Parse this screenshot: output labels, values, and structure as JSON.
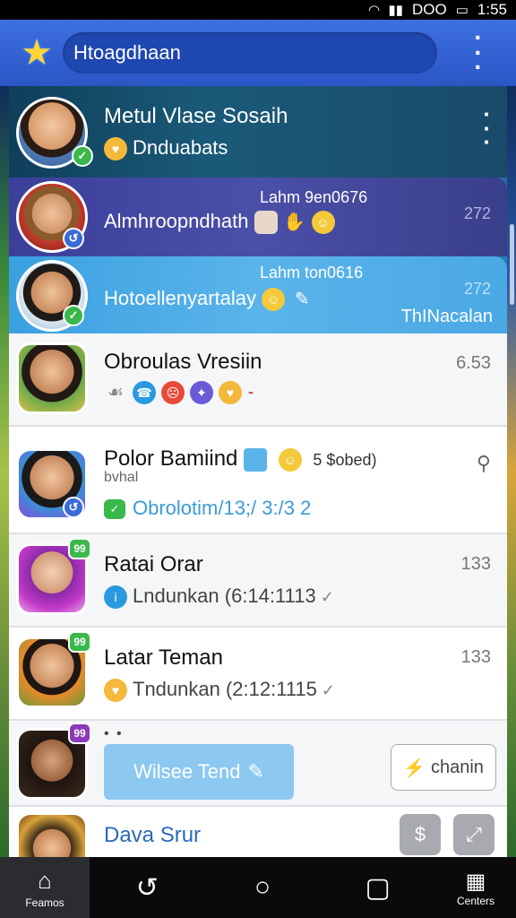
{
  "status_bar": {
    "time": "1:55",
    "carrier": "DOO"
  },
  "app": {
    "search_value": "Htoagdhaan"
  },
  "colors": {
    "topbar": "#2b56c6",
    "accent": "#3aa0e0",
    "badge_green": "#3ab84a",
    "badge_purple": "#8a3ab8"
  },
  "chats": [
    {
      "title": "Metul Vlase Sosaih",
      "preview": "Dnduabats"
    },
    {
      "top_label": "Lahm 9en0676",
      "preview": "Almhroopndhath",
      "time": "272"
    },
    {
      "top_label": "Lahm ton0616",
      "preview": "Hotoellenyartalay",
      "time": "272",
      "corner": "ThINacalan"
    },
    {
      "title": "Obroulas Vresiin",
      "time": "6.53"
    },
    {
      "title": "Polor Bamiind",
      "title_suffix": "5   $obed)",
      "name2": "bvhal",
      "preview": "Obrolotim/13;/ 3:/3 2"
    },
    {
      "title": "Ratai Orar",
      "preview": "Lndunkan (6:14:1113",
      "time": "133",
      "badge": "99"
    },
    {
      "title": "Latar Teman",
      "preview": "Tndunkan (2:12:1115",
      "time": "133",
      "badge": "99"
    },
    {
      "dots": "• •",
      "reply_label": "Wilsee Tend",
      "share_label": "chanin",
      "badge": "99"
    },
    {
      "title": "Dava Srur"
    }
  ],
  "navbar": {
    "home_label": "Feamos",
    "last_label": "Centers"
  }
}
